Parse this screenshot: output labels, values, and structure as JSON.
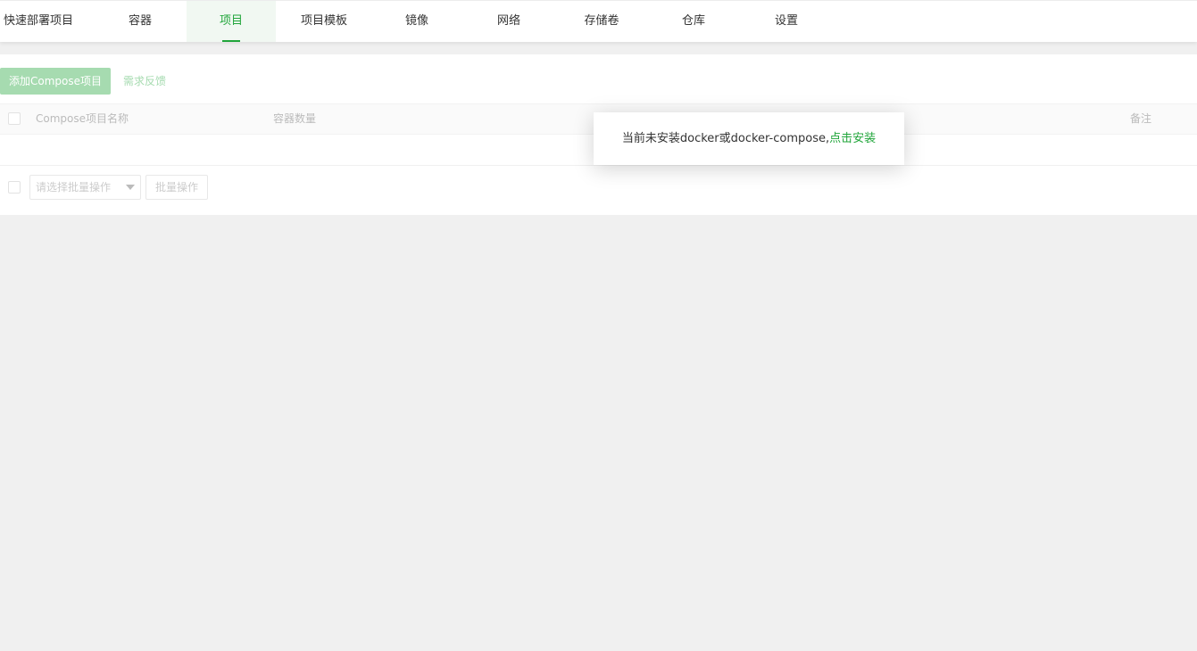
{
  "nav": {
    "tabs": [
      {
        "label": "快速部署项目"
      },
      {
        "label": "容器"
      },
      {
        "label": "项目"
      },
      {
        "label": "项目模板"
      },
      {
        "label": "镜像"
      },
      {
        "label": "网络"
      },
      {
        "label": "存储卷"
      },
      {
        "label": "仓库"
      },
      {
        "label": "设置"
      }
    ],
    "active_index": 2
  },
  "toolbar": {
    "add_label": "添加Compose项目",
    "feedback_label": "需求反馈"
  },
  "table": {
    "columns": [
      "Compose项目名称",
      "容器数量",
      "备注"
    ]
  },
  "batch": {
    "select_placeholder": "请选择批量操作",
    "button_label": "批量操作"
  },
  "notice": {
    "message": "当前未安装docker或docker-compose,",
    "link_label": "点击安装"
  },
  "colors": {
    "accent": "#20a53a",
    "accent_light": "#a6dbb0"
  }
}
